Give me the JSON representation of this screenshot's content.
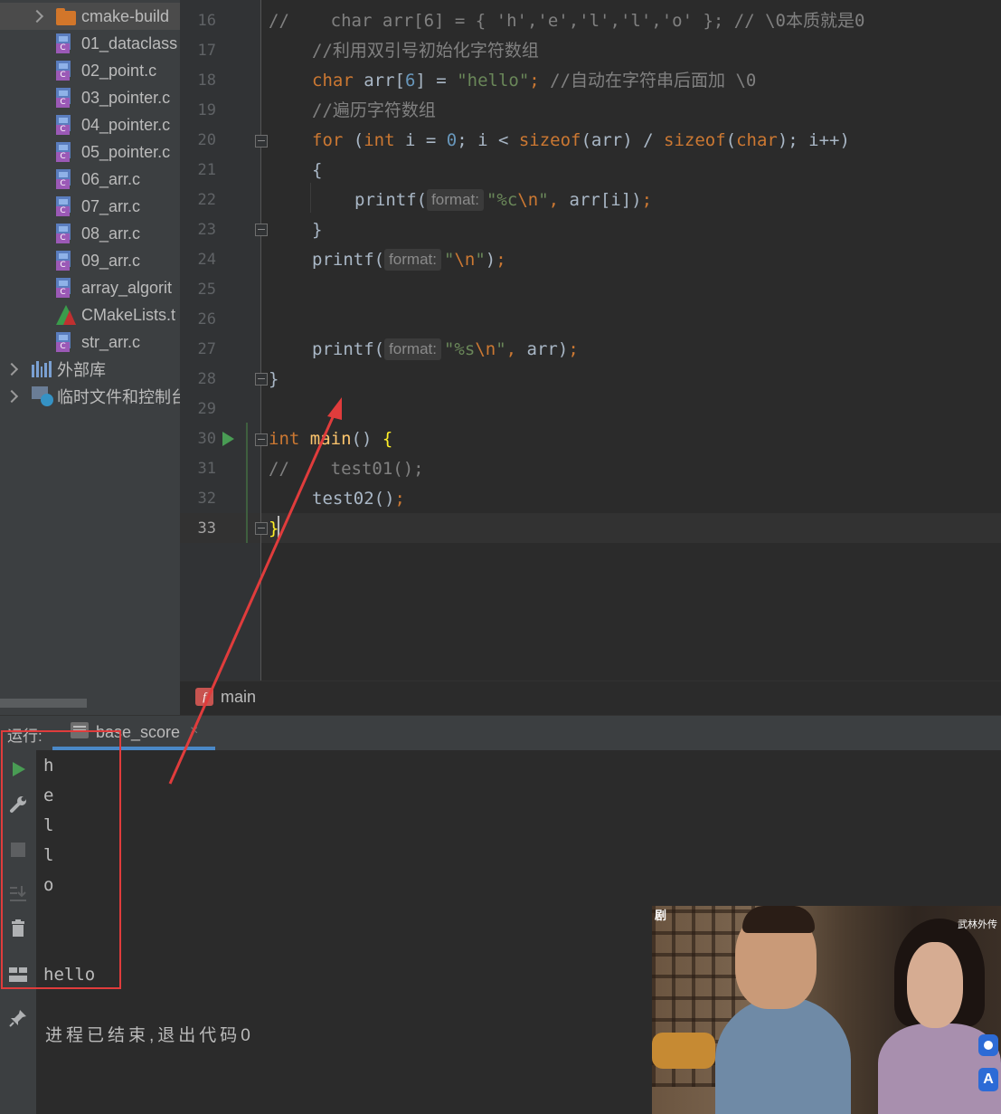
{
  "project_tree": {
    "items": [
      {
        "label": "cmake-build",
        "type": "folder",
        "collapsed": true,
        "selected": true
      },
      {
        "label": "01_dataclass",
        "type": "c-file"
      },
      {
        "label": "02_point.c",
        "type": "c-file"
      },
      {
        "label": "03_pointer.c",
        "type": "c-file"
      },
      {
        "label": "04_pointer.c",
        "type": "c-file"
      },
      {
        "label": "05_pointer.c",
        "type": "c-file"
      },
      {
        "label": "06_arr.c",
        "type": "c-file"
      },
      {
        "label": "07_arr.c",
        "type": "c-file"
      },
      {
        "label": "08_arr.c",
        "type": "c-file"
      },
      {
        "label": "09_arr.c",
        "type": "c-file"
      },
      {
        "label": "array_algorit",
        "type": "c-file"
      },
      {
        "label": "CMakeLists.t",
        "type": "cmake-file"
      },
      {
        "label": "str_arr.c",
        "type": "c-file"
      },
      {
        "label": "外部库",
        "type": "library",
        "collapsed": true
      },
      {
        "label": "临时文件和控制台",
        "type": "scratches",
        "collapsed": true
      }
    ]
  },
  "editor": {
    "line_numbers": [
      "16",
      "17",
      "18",
      "19",
      "20",
      "21",
      "22",
      "23",
      "24",
      "25",
      "26",
      "27",
      "28",
      "29",
      "30",
      "31",
      "32",
      "33"
    ],
    "current_line": "33",
    "code": {
      "l16": {
        "comment": "//",
        "rest": "    char arr[6] = { 'h','e','l','l','o' }; // \\0本质就是0"
      },
      "l17": {
        "comment": "//利用双引号初始化字符数组"
      },
      "l18": {
        "kw": "char",
        "ident": " arr[",
        "num": "6",
        "close": "] = ",
        "str": "\"hello\"",
        "semi": ";",
        "comment": " //自动在字符串后面加 \\0"
      },
      "l19": {
        "comment": "//遍历字符数组"
      },
      "l20": {
        "kw_for": "for",
        "p1": " (",
        "kw_int": "int",
        "p2": " i = ",
        "num": "0",
        "p3": "; i < ",
        "fn1": "sizeof",
        "p4": "(arr) / ",
        "fn2": "sizeof",
        "p5": "(",
        "kw_char": "char",
        "p6": "); i++)"
      },
      "l21": {
        "text": "{"
      },
      "l22": {
        "call": "printf(",
        "hint": "format:",
        "str_a": "\"%c",
        "esc": "\\n",
        "str_b": "\"",
        "comma": ",",
        "rest": " arr[i])",
        "semi": ";"
      },
      "l23": {
        "text": "}"
      },
      "l24": {
        "call": "printf(",
        "hint": "format:",
        "str_a": "\"",
        "esc": "\\n",
        "str_b": "\"",
        "rest": ")",
        "semi": ";"
      },
      "l27": {
        "call": "printf(",
        "hint": "format:",
        "str_a": "\"%s",
        "esc": "\\n",
        "str_b": "\"",
        "comma": ",",
        "rest": " arr)",
        "semi": ";"
      },
      "l28": {
        "text": "}"
      },
      "l30": {
        "kw": "int",
        "fn": " main",
        "rest": "() ",
        "brace": "{"
      },
      "l31": {
        "comment": "//",
        "rest": "    test01();"
      },
      "l32": {
        "call": "test02()",
        "semi": ";"
      },
      "l33": {
        "brace": "}"
      }
    }
  },
  "breadcrumb": {
    "icon": "f",
    "label": "main"
  },
  "run_panel": {
    "title": "运行:",
    "tab_label": "base_score",
    "tab_close": "×",
    "output_lines": [
      "h",
      "e",
      "l",
      "l",
      "o",
      "",
      "hello"
    ],
    "exit_message": "进程已结束,退出代码0"
  },
  "video_overlay": {
    "top_left_text": "剧",
    "top_right_text": "武林外传",
    "button_a": "A"
  },
  "colors": {
    "keyword": "#cc7832",
    "number": "#6897bb",
    "string": "#6a8759",
    "comment": "#808080",
    "annotation_red": "#e03c3c"
  }
}
